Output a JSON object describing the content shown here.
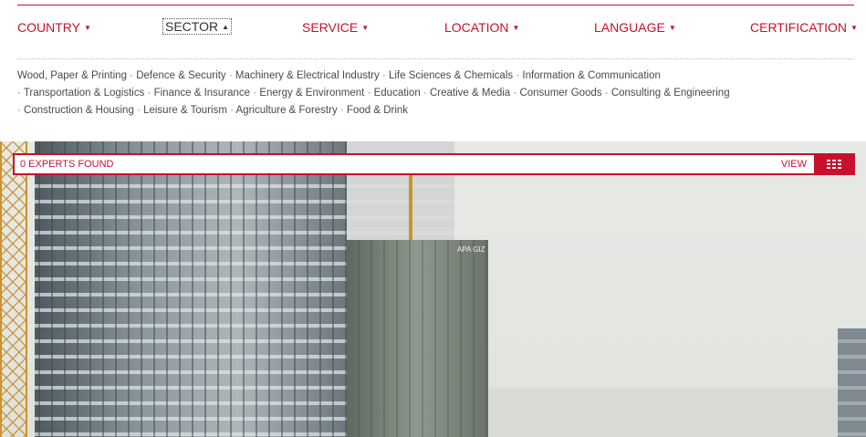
{
  "filters": [
    {
      "label": "COUNTRY"
    },
    {
      "label": "SECTOR"
    },
    {
      "label": "SERVICE"
    },
    {
      "label": "LOCATION"
    },
    {
      "label": "LANGUAGE"
    },
    {
      "label": "CERTIFICATION"
    }
  ],
  "sectors": {
    "line1": [
      "Wood, Paper & Printing",
      "Defence & Security",
      "Machinery & Electrical Industry",
      "Life Sciences & Chemicals",
      "Information & Communication"
    ],
    "line2": [
      "Transportation & Logistics",
      "Finance & Insurance",
      "Energy & Environment",
      "Education",
      "Creative & Media",
      "Consumer Goods",
      "Consulting & Engineering"
    ],
    "line3": [
      "Construction & Housing",
      "Leisure & Tourism",
      "Agriculture & Forestry",
      "Food & Drink"
    ]
  },
  "hero": {
    "building_sign": "APA GIZ"
  },
  "results": {
    "count_text": "0 EXPERTS FOUND",
    "view_label": "VIEW",
    "view_icon": "grid-icon"
  },
  "colors": {
    "accent": "#c8102e",
    "text": "#4a4a4a"
  }
}
